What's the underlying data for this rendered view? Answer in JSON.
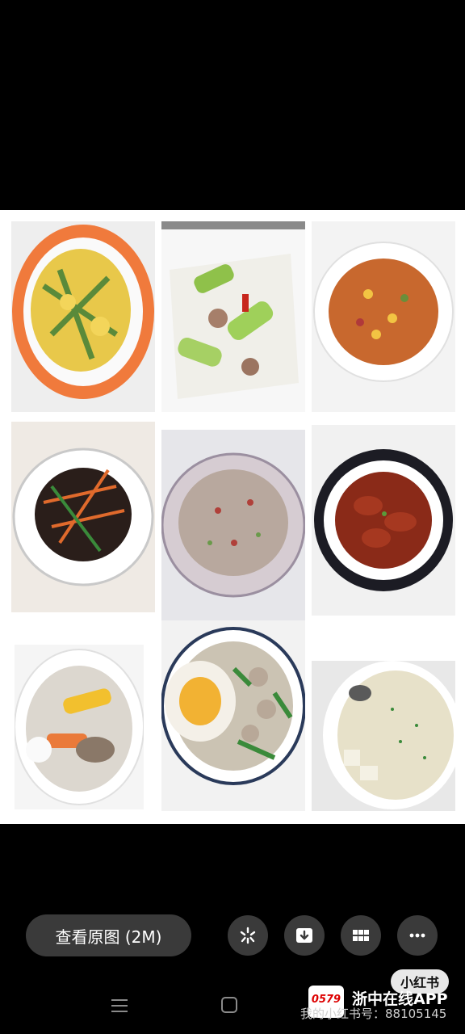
{
  "viewer": {
    "view_original_label": "查看原图 (2M)"
  },
  "toolbar_icons": [
    "lens-icon",
    "download-icon",
    "grid-icon",
    "more-icon"
  ],
  "photos": [
    {
      "dish": "scrambled-eggs-with-cucumber"
    },
    {
      "dish": "zucchini-stir-fry-with-pork"
    },
    {
      "dish": "diced-corn-and-sausage"
    },
    {
      "dish": "wood-ear-mushroom-with-carrot"
    },
    {
      "dish": "steamed-minced-pork"
    },
    {
      "dish": "braised-chicken-wings"
    },
    {
      "dish": "corn-and-rib-soup"
    },
    {
      "dish": "fried-egg-and-meatball-soup"
    },
    {
      "dish": "fish-and-tofu-soup"
    }
  ],
  "watermark": {
    "badge": "小红书",
    "logo": "0579",
    "brand": "浙中在线APP",
    "line": "我的小红书号：88105145"
  },
  "colors": {
    "background": "#000000",
    "button": "#3a3a3a",
    "collage_bg": "#ffffff"
  }
}
